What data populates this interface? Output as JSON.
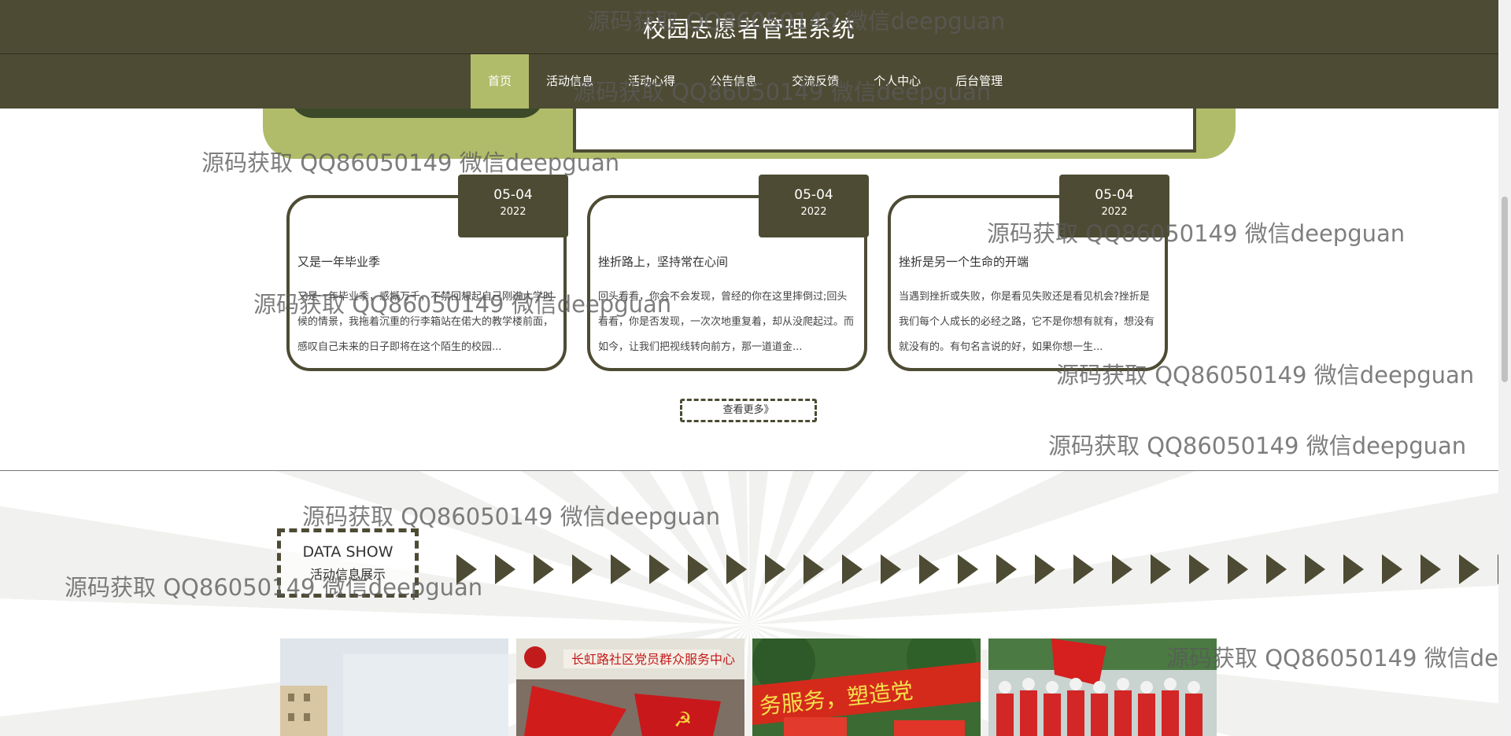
{
  "header": {
    "title": "校园志愿者管理系统",
    "nav": [
      "首页",
      "活动信息",
      "活动心得",
      "公告信息",
      "交流反馈",
      "个人中心",
      "后台管理"
    ],
    "active_index": 0
  },
  "news": [
    {
      "month_day": "05-04",
      "year": "2022",
      "title": "又是一年毕业季",
      "excerpt": "又是一年毕业季，感慨万千，不禁回想起自己刚进大学时候的情景，我拖着沉重的行李箱站在偌大的教学楼前面，感叹自己未来的日子即将在这个陌生的校园..."
    },
    {
      "month_day": "05-04",
      "year": "2022",
      "title": "挫折路上，坚持常在心间",
      "excerpt": "回头看看，你会不会发现，曾经的你在这里摔倒过;回头看看，你是否发现，一次次地重复着，却从没爬起过。而如今，让我们把视线转向前方，那一道道金..."
    },
    {
      "month_day": "05-04",
      "year": "2022",
      "title": "挫折是另一个生命的开端",
      "excerpt": "当遇到挫折或失败，你是看见失败还是看见机会?挫折是我们每个人成长的必经之路，它不是你想有就有，想没有就没有的。有句名言说的好，如果你想一生..."
    }
  ],
  "more_button": "查看更多》",
  "data_show": {
    "title_en": "DATA SHOW",
    "title_zh": "活动信息展示"
  },
  "watermark": "源码获取 QQ86050149 微信deepguan",
  "colors": {
    "primary": "#4d4b33",
    "accent": "#b1bc6a"
  },
  "icons": {
    "scroll_arrow": "triangle-right-icon"
  }
}
